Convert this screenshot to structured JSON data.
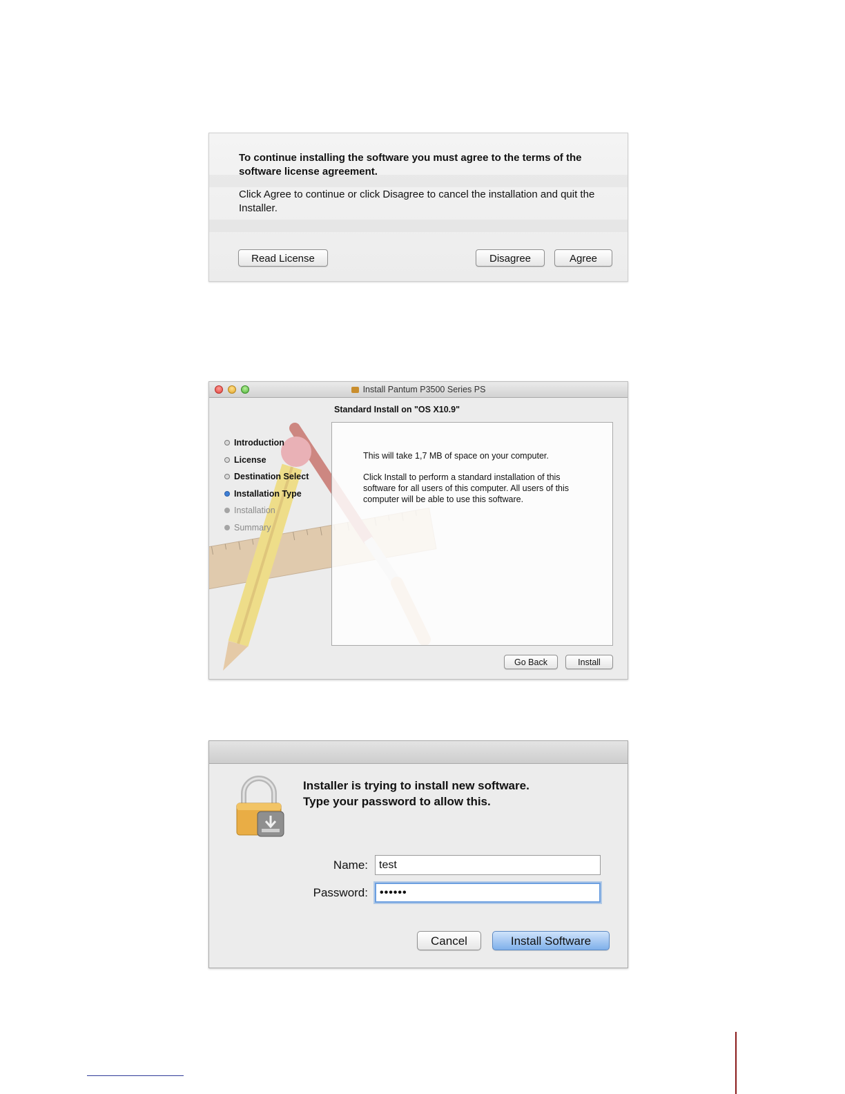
{
  "license_sheet": {
    "headline": "To continue installing the software you must agree to the terms of the software license agreement.",
    "body": "Click Agree to continue or click Disagree to cancel the installation and quit the Installer.",
    "read_license_label": "Read License",
    "disagree_label": "Disagree",
    "agree_label": "Agree"
  },
  "installer_window": {
    "title": "Install Pantum P3500 Series PS",
    "heading": "Standard Install on \"OS X10.9\"",
    "steps": [
      {
        "label": "Introduction",
        "state": "done"
      },
      {
        "label": "License",
        "state": "done"
      },
      {
        "label": "Destination Select",
        "state": "done"
      },
      {
        "label": "Installation Type",
        "state": "current"
      },
      {
        "label": "Installation",
        "state": "todo"
      },
      {
        "label": "Summary",
        "state": "todo"
      }
    ],
    "space_text": "This will take 1,7 MB of space on your computer.",
    "install_text": "Click Install to perform a standard installation of this software for all users of this computer. All users of this computer will be able to use this software.",
    "go_back_label": "Go Back",
    "install_label": "Install"
  },
  "auth_dialog": {
    "message_line1": "Installer is trying to install new software.",
    "message_line2": "Type your password to allow this.",
    "name_label": "Name:",
    "name_value": "test",
    "password_label": "Password:",
    "password_value": "••••••",
    "cancel_label": "Cancel",
    "install_software_label": "Install Software"
  },
  "colors": {
    "default_button": "#7fb0ea",
    "focus_ring": "#6b9fe0",
    "footer_rule": "#8a1a1a"
  }
}
